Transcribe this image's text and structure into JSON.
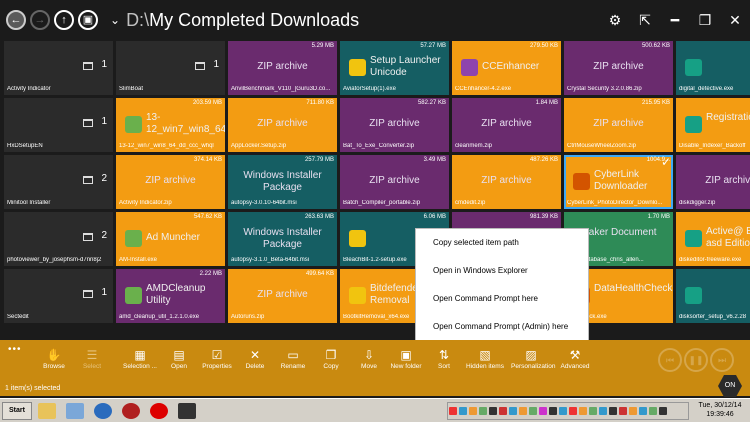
{
  "header": {
    "drive": "D:\\",
    "folder": "My Completed Downloads",
    "icons": [
      "back-icon",
      "forward-icon",
      "up-icon",
      "computer-icon",
      "settings-icon",
      "expand-icon",
      "minimize-icon",
      "close-icon"
    ]
  },
  "tiles": [
    {
      "name": "Activity Indicator",
      "type": "folder",
      "count": "1"
    },
    {
      "name": "SlimBoat",
      "type": "folder",
      "count": "1"
    },
    {
      "name": "AnvilBenchmark_V110_[Guru3D.co...",
      "type": "zip",
      "size": "5.29 MB",
      "label": "ZIP archive"
    },
    {
      "name": "AviatorSetup(1).exe",
      "type": "app",
      "size": "57.27 MB",
      "label": "Setup Launcher Unicode"
    },
    {
      "name": "CCEnhancer-4.2.exe",
      "type": "app",
      "size": "279.50 KB",
      "label": "CCEnhancer"
    },
    {
      "name": "Crystal Security 3.2.0.86.zip",
      "type": "zip",
      "size": "500.62 KB",
      "label": "ZIP archive"
    },
    {
      "name": "digital_detective.exe",
      "type": "app",
      "size": "",
      "label": ""
    },
    {
      "name": "HxDSetupEN",
      "type": "folder",
      "count": "1"
    },
    {
      "name": "13-12_win7_win8_64_dd_ccc_whql",
      "type": "app",
      "size": "203.59 MB",
      "label": "13-12_win7_win8_64_dd_ccc_whql"
    },
    {
      "name": "AppLocker.Setup.zip",
      "type": "zip",
      "size": "711.80 KB",
      "label": "ZIP archive"
    },
    {
      "name": "Bat_To_Exe_Converter.zip",
      "type": "zip",
      "size": "582.27 KB",
      "label": "ZIP archive"
    },
    {
      "name": "cleanmem.zip",
      "type": "zip",
      "size": "1.84 MB",
      "label": "ZIP archive"
    },
    {
      "name": "CtrlMouseWheelZoom.zip",
      "type": "zip",
      "size": "215.95 KB",
      "label": "ZIP archive"
    },
    {
      "name": "Disable_Indexer_Backoff",
      "type": "app",
      "size": "",
      "label": "Registration E"
    },
    {
      "name": "Minitool Installer",
      "type": "folder",
      "count": "2"
    },
    {
      "name": "Activity Indicator.zip",
      "type": "zip",
      "size": "374.14 KB",
      "label": "ZIP archive"
    },
    {
      "name": "autopsy-3.0.10-64bit.msi",
      "type": "msi",
      "size": "257.79 MB",
      "label": "Windows Installer Package"
    },
    {
      "name": "Batch_Compiler_portable.zip",
      "type": "zip",
      "size": "3.49 MB",
      "label": "ZIP archive"
    },
    {
      "name": "cmdedit.zip",
      "type": "zip",
      "size": "487.26 KB",
      "label": "ZIP archive"
    },
    {
      "name": "CyberLink_PhotoDirector_Downlo...",
      "type": "app",
      "size": "1004.9...",
      "label": "CyberLink Downloader"
    },
    {
      "name": "diskdigger.zip",
      "type": "zip",
      "size": "",
      "label": "ZIP archive"
    },
    {
      "name": "photoviewer_by_josephsm-d7nn8j2",
      "type": "folder",
      "count": "2"
    },
    {
      "name": "AM-Install.exe",
      "type": "app",
      "size": "547.62 KB",
      "label": "Ad Muncher"
    },
    {
      "name": "autopsy-3.1.0_Beta-64bit.msi",
      "type": "msi",
      "size": "263.63 MB",
      "label": "Windows Installer Package"
    },
    {
      "name": "BleachBit-1.2-setup.exe",
      "type": "app",
      "size": "6.06 MB",
      "label": ""
    },
    {
      "name": "",
      "type": "zip",
      "size": "981.39 KB",
      "label": ""
    },
    {
      "name": "care_database_chris_allen...",
      "type": "doc",
      "size": "1.70 MB",
      "label": "Maker Document"
    },
    {
      "name": "diskeditor-freeware.exe",
      "type": "app",
      "size": "",
      "label": "Active@ Editor - asd Edition"
    },
    {
      "name": "Sectedit",
      "type": "folder",
      "count": "1"
    },
    {
      "name": "amd_cleanup_util_1.2.1.0.exe",
      "type": "app",
      "size": "2.22 MB",
      "label": "AMDCleanup Utility"
    },
    {
      "name": "Autoruns.zip",
      "type": "zip",
      "size": "499.64 KB",
      "label": "ZIP archive"
    },
    {
      "name": "BootkitRemoval_x64.exe",
      "type": "app",
      "size": "",
      "label": "Bitdefender Removal"
    },
    {
      "name": "",
      "type": "zip",
      "size": "",
      "label": ""
    },
    {
      "name": "...lthCheck.exe",
      "type": "app",
      "size": "",
      "label": "DataHealthCheck"
    },
    {
      "name": "disksorter_setup_v6.2.28",
      "type": "app",
      "size": "",
      "label": ""
    }
  ],
  "context_menu": [
    "Copy selected item path",
    "Open in Windows Explorer",
    "Open Command Prompt here",
    "Open Command Prompt (Admin) here"
  ],
  "appbar": {
    "more": "•••",
    "buttons": [
      {
        "label": "Browse",
        "icon": "hand-icon",
        "enabled": true
      },
      {
        "label": "Select",
        "icon": "list-icon",
        "enabled": false
      },
      {
        "label": "Selection ...",
        "icon": "grid-select-icon",
        "enabled": true
      },
      {
        "label": "Open",
        "icon": "open-file-icon",
        "enabled": true
      },
      {
        "label": "Properties",
        "icon": "properties-icon",
        "enabled": true
      },
      {
        "label": "Delete",
        "icon": "x-icon",
        "enabled": true
      },
      {
        "label": "Rename",
        "icon": "rename-icon",
        "enabled": true
      },
      {
        "label": "Copy",
        "icon": "copy-icon",
        "enabled": true
      },
      {
        "label": "Move",
        "icon": "move-icon",
        "enabled": true
      },
      {
        "label": "New folder",
        "icon": "new-folder-icon",
        "enabled": true
      },
      {
        "label": "Sort",
        "icon": "sort-icon",
        "enabled": true
      },
      {
        "label": "Hidden items",
        "icon": "hidden-items-icon",
        "enabled": true
      },
      {
        "label": "Personalization",
        "icon": "personalization-icon",
        "enabled": true
      },
      {
        "label": "Advanced",
        "icon": "wrench-icon",
        "enabled": true
      }
    ],
    "badge": "ON"
  },
  "status": "1 item(s) selected",
  "taskbar": {
    "start": "Start",
    "clock_line1": "Tue, 30/12/14",
    "clock_line2": "19:39:46"
  },
  "colors": {
    "accent": "#c98a10",
    "purple": "#6a2b6e",
    "orange": "#f39c12",
    "selected": "#3fa9f5"
  }
}
